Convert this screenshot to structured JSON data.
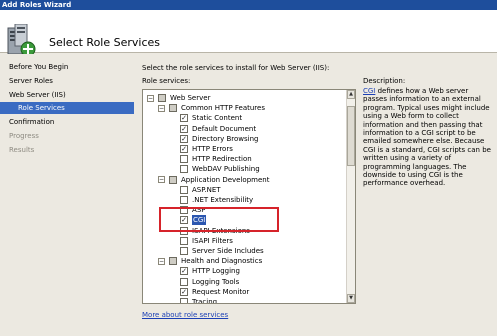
{
  "window": {
    "title": "Add Roles Wizard"
  },
  "header": {
    "title": "Select Role Services",
    "icon": "server-roles-icon"
  },
  "nav": {
    "items": [
      {
        "label": "Before You Begin",
        "state": "normal"
      },
      {
        "label": "Server Roles",
        "state": "normal"
      },
      {
        "label": "Web Server (IIS)",
        "state": "normal"
      },
      {
        "label": "Role Services",
        "state": "selected"
      },
      {
        "label": "Confirmation",
        "state": "normal"
      },
      {
        "label": "Progress",
        "state": "disabled"
      },
      {
        "label": "Results",
        "state": "disabled"
      }
    ]
  },
  "main": {
    "instruction": "Select the role services to install for Web Server (IIS):",
    "services_label": "Role services:",
    "tree": [
      {
        "label": "Web Server",
        "level": 0,
        "expander": "-",
        "checked": "partial"
      },
      {
        "label": "Common HTTP Features",
        "level": 1,
        "expander": "-",
        "checked": "partial"
      },
      {
        "label": "Static Content",
        "level": 2,
        "checked": "checked"
      },
      {
        "label": "Default Document",
        "level": 2,
        "checked": "checked"
      },
      {
        "label": "Directory Browsing",
        "level": 2,
        "checked": "checked"
      },
      {
        "label": "HTTP Errors",
        "level": 2,
        "checked": "checked"
      },
      {
        "label": "HTTP Redirection",
        "level": 2,
        "checked": "unchecked"
      },
      {
        "label": "WebDAV Publishing",
        "level": 2,
        "checked": "unchecked"
      },
      {
        "label": "Application Development",
        "level": 1,
        "expander": "-",
        "checked": "partial"
      },
      {
        "label": "ASP.NET",
        "level": 2,
        "checked": "unchecked"
      },
      {
        "label": ".NET Extensibility",
        "level": 2,
        "checked": "unchecked"
      },
      {
        "label": "ASP",
        "level": 2,
        "checked": "unchecked"
      },
      {
        "label": "CGI",
        "level": 2,
        "checked": "checked",
        "selected": true
      },
      {
        "label": "ISAPI Extensions",
        "level": 2,
        "checked": "unchecked"
      },
      {
        "label": "ISAPI Filters",
        "level": 2,
        "checked": "unchecked"
      },
      {
        "label": "Server Side Includes",
        "level": 2,
        "checked": "unchecked"
      },
      {
        "label": "Health and Diagnostics",
        "level": 1,
        "expander": "-",
        "checked": "partial"
      },
      {
        "label": "HTTP Logging",
        "level": 2,
        "checked": "checked"
      },
      {
        "label": "Logging Tools",
        "level": 2,
        "checked": "unchecked"
      },
      {
        "label": "Request Monitor",
        "level": 2,
        "checked": "checked"
      },
      {
        "label": "Tracing",
        "level": 2,
        "checked": "unchecked"
      }
    ],
    "more_link": "More about role services"
  },
  "description": {
    "label": "Description:",
    "link": "CGI",
    "text": " defines how a Web server passes information to an external program. Typical uses might include using a Web form to collect information and then passing that information to a CGI script to be emailed somewhere else. Because CGI is a standard, CGI scripts can be written using a variety of programming languages. The downside to using CGI is the performance overhead."
  },
  "colors": {
    "titlebar": "#1e4e9c",
    "nav_selected": "#3a6bc2",
    "highlight_box": "#d6232a",
    "link": "#1b3fb5"
  }
}
